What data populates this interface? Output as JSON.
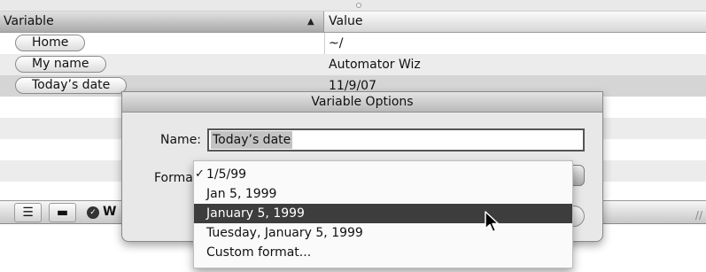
{
  "table": {
    "col_variable": "Variable",
    "col_value": "Value",
    "rows": [
      {
        "name": "Home",
        "value": "~/"
      },
      {
        "name": "My name",
        "value": "Automator Wiz"
      },
      {
        "name": "Today’s date",
        "value": "11/9/07"
      }
    ],
    "bottom_label": "W"
  },
  "dialog": {
    "title": "Variable Options",
    "name_label": "Name:",
    "name_value": "Today’s date",
    "format_label": "Format"
  },
  "format_menu": {
    "items": [
      {
        "label": "1/5/99",
        "checked": true
      },
      {
        "label": "Jan 5, 1999"
      },
      {
        "label": "January 5, 1999",
        "highlighted": true
      },
      {
        "label": "Tuesday, January 5, 1999"
      },
      {
        "label": "Custom format..."
      }
    ],
    "checkmark": "✓"
  },
  "icons": {
    "sort": "▲",
    "list_view": "☰",
    "compact_view": "▬",
    "check": "✓",
    "resize": "//"
  },
  "colors": {
    "highlight": "#3d3d3d",
    "selected_row": "#d5d5d5"
  }
}
